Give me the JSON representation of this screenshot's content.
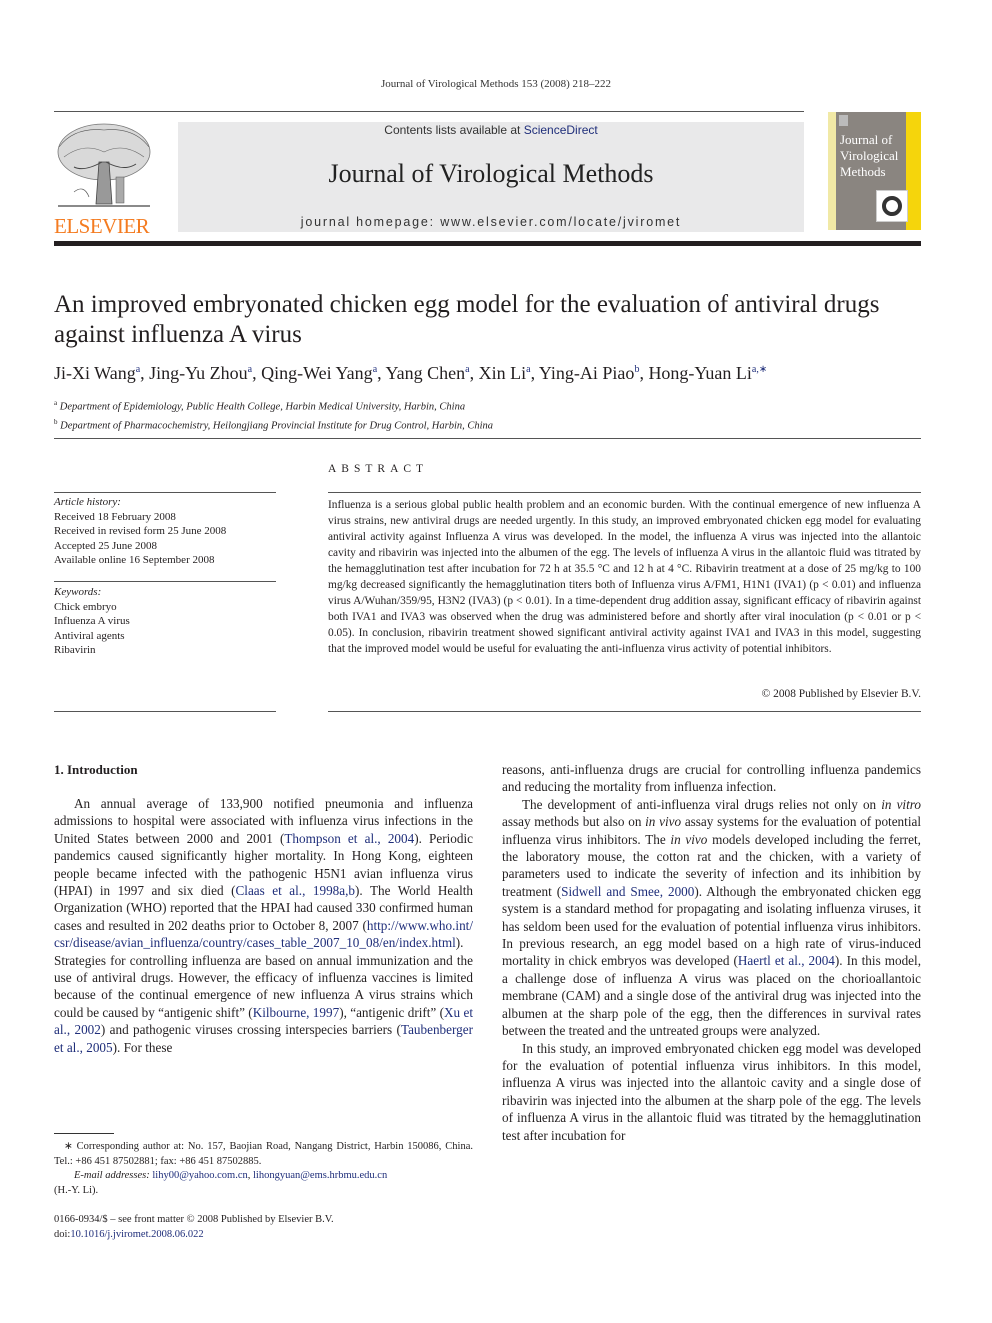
{
  "running_head": "Journal of Virological Methods 153 (2008) 218–222",
  "publisher": {
    "logo_text": "ELSEVIER",
    "logo_color": "#f47b20"
  },
  "banner": {
    "contents_prefix": "Contents lists available at ",
    "contents_link": "ScienceDirect",
    "journal_title": "Journal of Virological Methods",
    "homepage": "journal homepage: www.elsevier.com/locate/jviromet"
  },
  "cover": {
    "title_lines": [
      "Journal of",
      "Virological",
      "Methods"
    ]
  },
  "article": {
    "title": "An improved embryonated chicken egg model for the evaluation of antiviral drugs against influenza A virus",
    "authors": [
      {
        "name": "Ji-Xi Wang",
        "aff": "a"
      },
      {
        "name": "Jing-Yu Zhou",
        "aff": "a"
      },
      {
        "name": "Qing-Wei Yang",
        "aff": "a"
      },
      {
        "name": "Yang Chen",
        "aff": "a"
      },
      {
        "name": "Xin Li",
        "aff": "a"
      },
      {
        "name": "Ying-Ai Piao",
        "aff": "b"
      },
      {
        "name": "Hong-Yuan Li",
        "aff": "a,∗"
      }
    ],
    "affiliations": [
      {
        "mark": "a",
        "text": "Department of Epidemiology, Public Health College, Harbin Medical University, Harbin, China"
      },
      {
        "mark": "b",
        "text": "Department of Pharmacochemistry, Heilongjiang Provincial Institute for Drug Control, Harbin, China"
      }
    ]
  },
  "article_info": {
    "history_label": "Article history:",
    "history": [
      "Received 18 February 2008",
      "Received in revised form 25 June 2008",
      "Accepted 25 June 2008",
      "Available online 16 September 2008"
    ],
    "keywords_label": "Keywords:",
    "keywords": [
      "Chick embryo",
      "Influenza A virus",
      "Antiviral agents",
      "Ribavirin"
    ]
  },
  "abstract": {
    "heading": "ABSTRACT",
    "text": "Influenza is a serious global public health problem and an economic burden. With the continual emergence of new influenza A virus strains, new antiviral drugs are needed urgently. In this study, an improved embryonated chicken egg model for evaluating antiviral activity against Influenza A virus was developed. In the model, the influenza A virus was injected into the allantoic cavity and ribavirin was injected into the albumen of the egg. The levels of influenza A virus in the allantoic fluid was titrated by the hemagglutination test after incubation for 72 h at 35.5 °C and 12 h at 4 °C. Ribavirin treatment at a dose of 25 mg/kg to 100 mg/kg decreased significantly the hemagglutination titers both of Influenza virus A/FM1, H1N1 (IVA1) (p < 0.01) and influenza virus A/Wuhan/359/95, H3N2 (IVA3) (p < 0.01). In a time-dependent drug addition assay, significant efficacy of ribavirin against both IVA1 and IVA3 was observed when the drug was administered before and shortly after viral inoculation (p < 0.01 or p < 0.05). In conclusion, ribavirin treatment showed significant antiviral activity against IVA1 and IVA3 in this model, suggesting that the improved model would be useful for evaluating the anti-influenza virus activity of potential inhibitors.",
    "copyright": "© 2008 Published by Elsevier B.V."
  },
  "introduction": {
    "heading": "1.  Introduction",
    "col1": {
      "p1_a": "An annual average of 133,900 notified pneumonia and influenza admissions to hospital were associated with influenza virus infections in the United States between 2000 and 2001 (",
      "ref1": "Thompson et al., 2004",
      "p1_b": "). Periodic pandemics caused significantly higher mortality. In Hong Kong, eighteen people became infected with the pathogenic H5N1 avian influenza virus (HPAI) in 1997 and six died (",
      "ref2": "Claas et al., 1998a,b",
      "p1_c": "). The World Health Organization (WHO) reported that the HPAI had caused 330 confirmed human cases and resulted in 202 deaths prior to October 8, 2007 (",
      "url": "http://www.who.int/csr/disease/avian_influenza/country/cases_table_2007_10_08/en/index.html",
      "p1_d": "). Strategies for controlling influenza are based on annual immunization and the use of antiviral drugs. However, the efficacy of influenza vaccines is limited because of the continual emergence of new influenza A virus strains which could be caused by “antigenic shift” (",
      "ref3": "Kilbourne, 1997",
      "p1_e": "), “antigenic drift” (",
      "ref4": "Xu et al., 2002",
      "p1_f": ") and pathogenic viruses crossing interspecies barriers (",
      "ref5": "Taubenberger et al., 2005",
      "p1_g": "). For these"
    },
    "col2": {
      "p0": "reasons, anti-influenza drugs are crucial for controlling influenza pandemics and reducing the mortality from influenza infection.",
      "p2_a": "The development of anti-influenza viral drugs relies not only on ",
      "p2_i1": "in vitro",
      "p2_b": " assay methods but also on ",
      "p2_i2": "in vivo",
      "p2_c": " assay systems for the evaluation of potential influenza virus inhibitors. The ",
      "p2_i3": "in vivo",
      "p2_d": " models developed including the ferret, the laboratory mouse, the cotton rat and the chicken, with a variety of parameters used to indicate the severity of infection and its inhibition by treatment (",
      "ref6": "Sidwell and Smee, 2000",
      "p2_e": "). Although the embryonated chicken egg system is a standard method for propagating and isolating influenza viruses, it has seldom been used for the evaluation of potential influenza virus inhibitors. In previous research, an egg model based on a high rate of virus-induced mortality in chick embryos was developed (",
      "ref7": "Haertl et al., 2004",
      "p2_f": "). In this model, a challenge dose of influenza A virus was placed on the chorioallantoic membrane (CAM) and a single dose of the antiviral drug was injected into the albumen at the sharp pole of the egg, then the differences in survival rates between the treated and the untreated groups were analyzed.",
      "p3": "In this study, an improved embryonated chicken egg model was developed for the evaluation of potential influenza virus inhibitors. In this model, influenza A virus was injected into the allantoic cavity and a single dose of ribavirin was injected into the albumen at the sharp pole of the egg. The levels of influenza A virus in the allantoic fluid was titrated by the hemagglutination test after incubation for"
    }
  },
  "footnote": {
    "corresponding": "∗  Corresponding author at: No. 157, Baojian Road, Nangang District, Harbin 150086, China. Tel.: +86 451 87502881; fax: +86 451 87502885.",
    "email_label": "E-mail addresses:",
    "email1": "lihy00@yahoo.com.cn",
    "email2": "lihongyuan@ems.hrbmu.edu.cn",
    "email_suffix": "(H.-Y. Li)."
  },
  "front_matter": {
    "issn_line": "0166-0934/$ – see front matter © 2008 Published by Elsevier B.V.",
    "doi_prefix": "doi:",
    "doi": "10.1016/j.jviromet.2008.06.022"
  }
}
